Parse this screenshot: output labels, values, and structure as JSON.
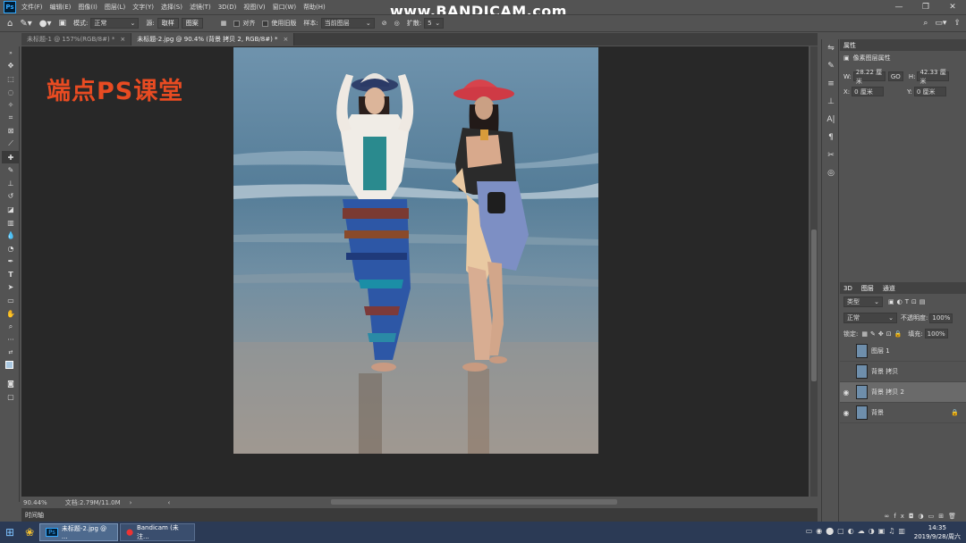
{
  "menu": {
    "items": [
      "文件(F)",
      "编辑(E)",
      "图像(I)",
      "图层(L)",
      "文字(Y)",
      "选择(S)",
      "滤镜(T)",
      "3D(D)",
      "视图(V)",
      "窗口(W)",
      "帮助(H)"
    ]
  },
  "watermark": "www.BANDICAM.com",
  "options": {
    "mode_label": "模式:",
    "mode_value": "正常",
    "source_label": "源:",
    "btn_sample": "取样",
    "btn_pattern": "图案",
    "align_label": "对齐",
    "legacy_label": "使用旧版",
    "sample_label": "样本:",
    "sample_value": "当前图层",
    "spread_label": "扩散:",
    "spread_value": "5"
  },
  "tabs": [
    {
      "label": "未标题-1 @ 157%(RGB/8#) *"
    },
    {
      "label": "未标题-2.jpg @ 90.4% (背景 拷贝 2, RGB/8#) *"
    }
  ],
  "canvas": {
    "logo_text": "端点PS课堂"
  },
  "status": {
    "zoom": "90.44%",
    "doc": "文档:2.79M/11.0M"
  },
  "timeline_label": "时间轴",
  "properties": {
    "title": "属性",
    "subtitle": "像素图层属性",
    "w_label": "W:",
    "w_value": "28.22 厘米",
    "link": "GO",
    "h_label": "H:",
    "h_value": "42.33 厘米",
    "x_label": "X:",
    "x_value": "0 厘米",
    "y_label": "Y:",
    "y_value": "0 厘米"
  },
  "layers_panel": {
    "tabs": [
      "3D",
      "图层",
      "通道"
    ],
    "filter": "类型",
    "blend": "正常",
    "opacity_label": "不透明度:",
    "opacity_value": "100%",
    "lock_label": "锁定:",
    "fill_label": "填充:",
    "fill_value": "100%",
    "layers": [
      {
        "name": "图层 1",
        "visible": false
      },
      {
        "name": "背景 拷贝",
        "visible": false
      },
      {
        "name": "背景 拷贝 2",
        "visible": true
      },
      {
        "name": "背景",
        "visible": true
      }
    ]
  },
  "taskbar": {
    "items": [
      "未标题-2.jpg @ ...",
      "Bandicam (未注..."
    ],
    "time": "14:35",
    "date": "2019/9/28/周六"
  },
  "colors": {
    "accent_logo": "#e84b22",
    "bg": "#535353",
    "canvas": "#282828"
  }
}
